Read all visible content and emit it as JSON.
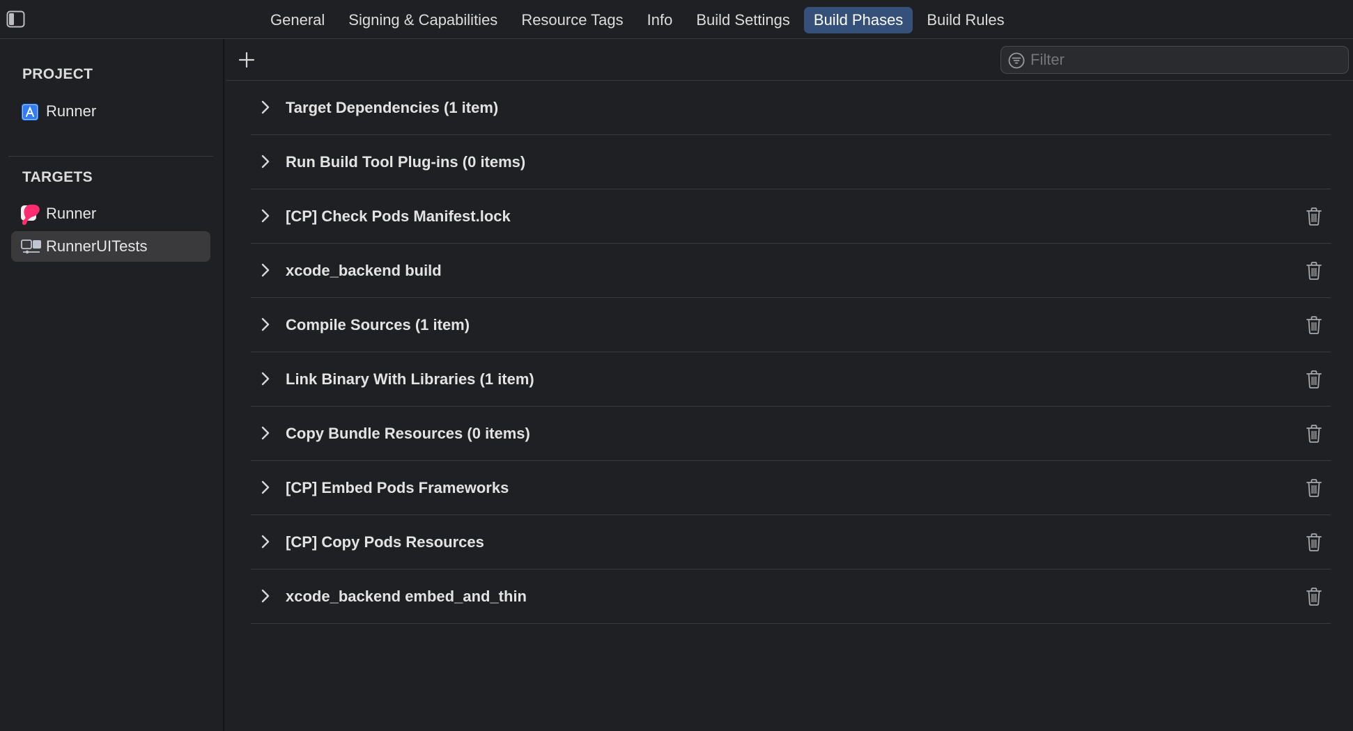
{
  "tabs": [
    {
      "label": "General"
    },
    {
      "label": "Signing & Capabilities"
    },
    {
      "label": "Resource Tags"
    },
    {
      "label": "Info"
    },
    {
      "label": "Build Settings"
    },
    {
      "label": "Build Phases",
      "active": true
    },
    {
      "label": "Build Rules"
    }
  ],
  "sidebar": {
    "project_heading": "PROJECT",
    "project_items": [
      {
        "label": "Runner",
        "icon": "xcode-project-icon"
      }
    ],
    "targets_heading": "TARGETS",
    "target_items": [
      {
        "label": "Runner",
        "icon": "app-target-icon"
      },
      {
        "label": "RunnerUITests",
        "icon": "ui-test-target-icon",
        "selected": true
      }
    ]
  },
  "toolbar": {
    "add_icon": "plus-icon",
    "filter_placeholder": "Filter",
    "filter_value": ""
  },
  "phases": [
    {
      "title": "Target Dependencies (1 item)",
      "deletable": false
    },
    {
      "title": "Run Build Tool Plug-ins (0 items)",
      "deletable": false
    },
    {
      "title": "[CP] Check Pods Manifest.lock",
      "deletable": true
    },
    {
      "title": "xcode_backend build",
      "deletable": true
    },
    {
      "title": "Compile Sources (1 item)",
      "deletable": true
    },
    {
      "title": "Link Binary With Libraries (1 item)",
      "deletable": true
    },
    {
      "title": "Copy Bundle Resources (0 items)",
      "deletable": true
    },
    {
      "title": "[CP] Embed Pods Frameworks",
      "deletable": true
    },
    {
      "title": "[CP] Copy Pods Resources",
      "deletable": true
    },
    {
      "title": "xcode_backend embed_and_thin",
      "deletable": true
    }
  ],
  "colors": {
    "background": "#1f2023",
    "active_tab": "#355079",
    "selected_row": "#3a3a3d",
    "accent_blue": "#2f7cf6",
    "marker_pink": "#ff2d6f"
  }
}
